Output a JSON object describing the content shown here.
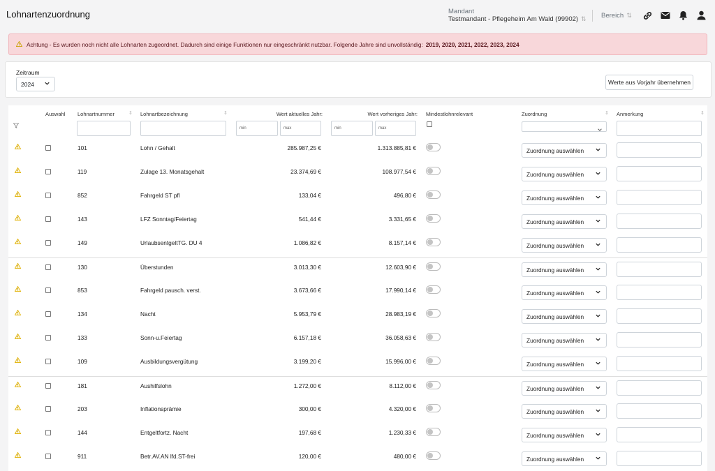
{
  "header": {
    "title": "Lohnartenzuordnung",
    "mandant_label": "Mandant",
    "mandant_value": "Testmandant - Pflegeheim Am Wald (99902)",
    "bereich_label": "Bereich",
    "icons": [
      "link-icon",
      "mail-icon",
      "bell-icon",
      "user-icon"
    ]
  },
  "alert": {
    "text": "Achtung - Es wurden noch nicht alle Lohnarten zugeordnet. Dadurch sind einige Funktionen nur eingeschränkt nutzbar. Folgende Jahre sind unvollständig:",
    "years": "2019, 2020, 2021, 2022, 2023, 2024"
  },
  "filter": {
    "zeitraum_label": "Zeitraum",
    "zeitraum_value": "2024",
    "copy_button": "Werte aus Vorjahr übernehmen"
  },
  "table": {
    "headers": {
      "auswahl": "Auswahl",
      "nummer": "Lohnartnummer",
      "bezeichnung": "Lohnartbezeichnung",
      "aktuell": "Wert aktuelles Jahr:",
      "vorjahr": "Wert vorheriges Jahr:",
      "mindestlohn": "Mindestlohnrelevant",
      "zuordnung": "Zuordnung",
      "anmerkung": "Anmerkung"
    },
    "placeholders": {
      "min": "min",
      "max": "max"
    },
    "select_placeholder": "Zuordnung auswählen",
    "rows": [
      {
        "nr": "101",
        "bez": "Lohn / Gehalt",
        "akt": "285.987,25 €",
        "vor": "1.313.885,81 €"
      },
      {
        "nr": "119",
        "bez": "Zulage 13. Monatsgehalt",
        "akt": "23.374,69 €",
        "vor": "108.977,54 €"
      },
      {
        "nr": "852",
        "bez": "Fahrgeld ST pfl",
        "akt": "133,04 €",
        "vor": "496,80 €"
      },
      {
        "nr": "143",
        "bez": "LFZ Sonntag/Feiertag",
        "akt": "541,44 €",
        "vor": "3.331,65 €"
      },
      {
        "nr": "149",
        "bez": "UrlaubsentgeltTG. DU 4",
        "akt": "1.086,82 €",
        "vor": "8.157,14 €"
      },
      {
        "nr": "130",
        "bez": "Überstunden",
        "akt": "3.013,30 €",
        "vor": "12.603,90 €"
      },
      {
        "nr": "853",
        "bez": "Fahrgeld pausch. verst.",
        "akt": "3.673,66 €",
        "vor": "17.990,14 €"
      },
      {
        "nr": "134",
        "bez": "Nacht",
        "akt": "5.953,79 €",
        "vor": "28.983,19 €"
      },
      {
        "nr": "133",
        "bez": "Sonn-u.Feiertag",
        "akt": "6.157,18 €",
        "vor": "36.058,63 €"
      },
      {
        "nr": "109",
        "bez": "Ausbildungsvergütung",
        "akt": "3.199,20 €",
        "vor": "15.996,00 €"
      },
      {
        "nr": "181",
        "bez": "Aushilfslohn",
        "akt": "1.272,00 €",
        "vor": "8.112,00 €"
      },
      {
        "nr": "203",
        "bez": "Inflationsprämie",
        "akt": "300,00 €",
        "vor": "4.320,00 €"
      },
      {
        "nr": "144",
        "bez": "Entgeltfortz. Nacht",
        "akt": "197,68 €",
        "vor": "1.230,33 €"
      },
      {
        "nr": "911",
        "bez": "Betr.AV.AN lfd.ST-frei",
        "akt": "120,00 €",
        "vor": "480,00 €"
      }
    ]
  }
}
